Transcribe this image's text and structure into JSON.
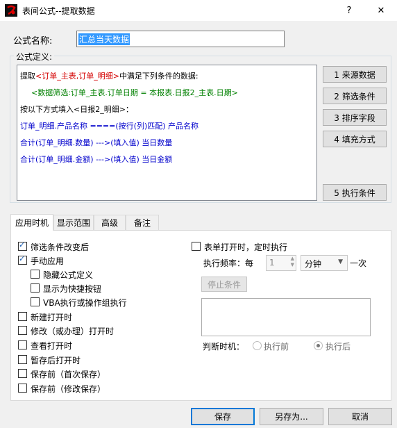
{
  "window": {
    "title": "表间公式--提取数据",
    "help": "?",
    "close": "✕"
  },
  "name_field": {
    "label": "公式名称:",
    "value": "汇总当天数据"
  },
  "definition": {
    "legend": "公式定义:",
    "line1": {
      "a": "提取",
      "b": "<订单_主表,订单_明细>",
      "c": "中满足下列条件的数据:"
    },
    "line2": "<数据筛选:订单_主表.订单日期 = 本报表.日报2_主表.日期>",
    "line3": "按以下方式填入<日报2_明细>：",
    "line4": "订单_明细.产品名称  ====(按行(列)匹配)  产品名称",
    "line5": "合计(订单_明细.数量)  --->(填入值)  当日数量",
    "line6": "合计(订单_明细.金额)  --->(填入值)  当日金额"
  },
  "side_buttons": [
    "1  来源数据",
    "2  筛选条件",
    "3  排序字段",
    "4 填充方式",
    "5 执行条件"
  ],
  "tabs": [
    "应用时机",
    "显示范围",
    "高级",
    "备注"
  ],
  "options_left": [
    {
      "label": "筛选条件改变后",
      "checked": true
    },
    {
      "label": "手动应用",
      "checked": true
    },
    {
      "label": "隐藏公式定义",
      "checked": false
    },
    {
      "label": "显示为快捷按钮",
      "checked": false
    },
    {
      "label": "VBA执行或操作组执行",
      "checked": false
    },
    {
      "label": "新建打开时",
      "checked": false
    },
    {
      "label": "修改（或办理）打开时",
      "checked": false
    },
    {
      "label": "查看打开时",
      "checked": false
    },
    {
      "label": "暂存后打开时",
      "checked": false
    },
    {
      "label": "保存前（首次保存）",
      "checked": false
    },
    {
      "label": "保存前（修改保存）",
      "checked": false
    }
  ],
  "timer": {
    "label": "表单打开时，定时执行",
    "checked": false,
    "freq_label": "执行频率：每",
    "freq_value": "1",
    "unit": "分钟",
    "suffix": "一次",
    "stop_button": "停止条件",
    "judge_label": "判断时机：",
    "before": "执行前",
    "after": "执行后",
    "selected": "执行后"
  },
  "bottom_buttons": {
    "save": "保存",
    "save_as": "另存为...",
    "cancel": "取消"
  },
  "colors": {
    "red": "#d40000",
    "green": "#008000",
    "blue": "#0000cc"
  }
}
